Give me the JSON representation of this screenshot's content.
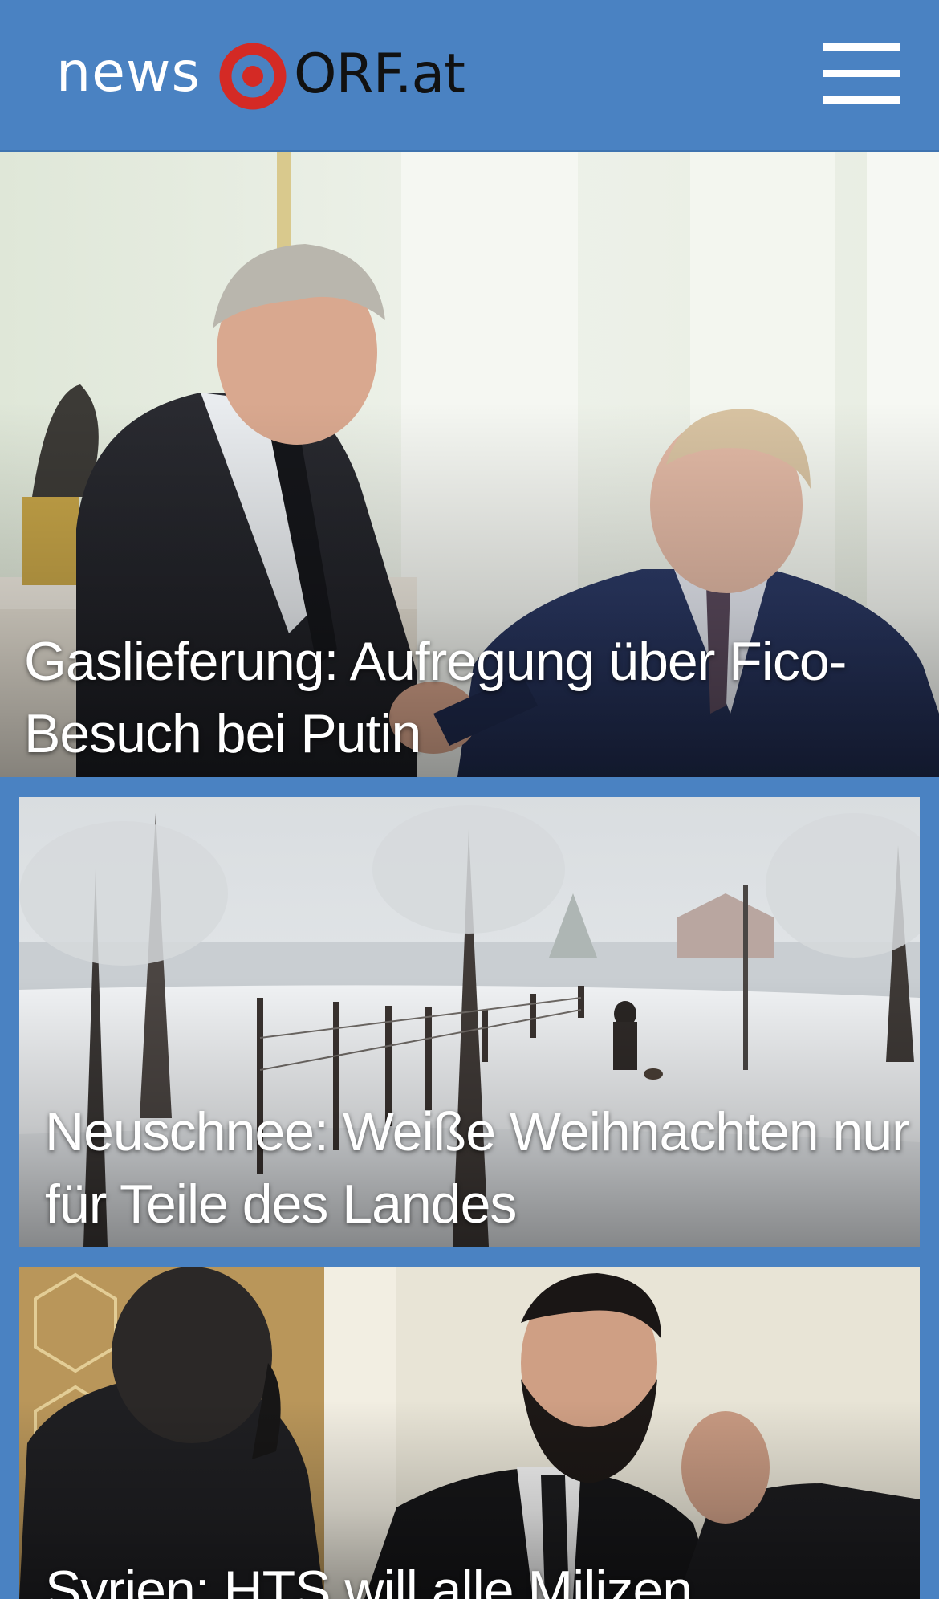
{
  "header": {
    "logo": {
      "part_news": "news",
      "part_orf": "ORF.at"
    },
    "menu_icon": "hamburger-menu-icon"
  },
  "colors": {
    "header_background": "#4a82c2",
    "logo_ring": "#d42a25",
    "headline_text": "#ffffff"
  },
  "stories": [
    {
      "headline": "Gaslieferung: Aufregung über Fico-Besuch bei Putin",
      "image": "photo-two-politicians-shaking-hands"
    },
    {
      "headline": "Neuschnee: Weiße Weihnachten nur für Teile des Landes",
      "image": "photo-snowy-landscape-person-walking-dog"
    },
    {
      "headline": "Syrien: HTS will alle Milizen",
      "image": "photo-man-with-beard-in-suit"
    }
  ]
}
